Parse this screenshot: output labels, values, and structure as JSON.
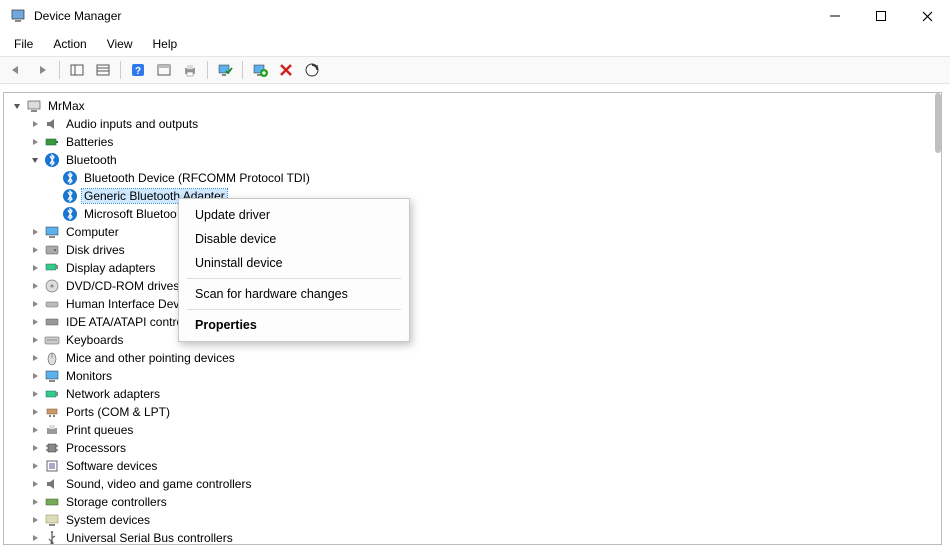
{
  "window": {
    "title": "Device Manager"
  },
  "menu": {
    "file": "File",
    "action": "Action",
    "view": "View",
    "help": "Help"
  },
  "toolbar_icons": {
    "back": "back-arrow-icon",
    "forward": "forward-arrow-icon",
    "showhide": "showhide-tree-icon",
    "list": "list-icon",
    "help": "help-icon",
    "details": "details-icon",
    "print": "print-icon",
    "monitor_check": "monitor-check-icon",
    "monitor_plus": "monitor-plus-icon",
    "delete": "delete-icon",
    "scan": "scan-icon"
  },
  "tree": {
    "root": "MrMax",
    "audio": "Audio inputs and outputs",
    "batteries": "Batteries",
    "bluetooth": "Bluetooth",
    "bt_rfcomm": "Bluetooth Device (RFCOMM Protocol TDI)",
    "bt_generic": "Generic Bluetooth Adapter",
    "bt_microsoft": "Microsoft Bluetoo",
    "computer": "Computer",
    "disk": "Disk drives",
    "display": "Display adapters",
    "dvd": "DVD/CD-ROM drives",
    "hid": "Human Interface Dev",
    "ide": "IDE ATA/ATAPI contro",
    "keyboards": "Keyboards",
    "mice": "Mice and other pointing devices",
    "monitors": "Monitors",
    "network": "Network adapters",
    "ports": "Ports (COM & LPT)",
    "printq": "Print queues",
    "processors": "Processors",
    "software": "Software devices",
    "sound": "Sound, video and game controllers",
    "storagectrl": "Storage controllers",
    "sysdev": "System devices",
    "usb": "Universal Serial Bus controllers"
  },
  "context_menu": {
    "update": "Update driver",
    "disable": "Disable device",
    "uninstall": "Uninstall device",
    "scan": "Scan for hardware changes",
    "properties": "Properties"
  }
}
